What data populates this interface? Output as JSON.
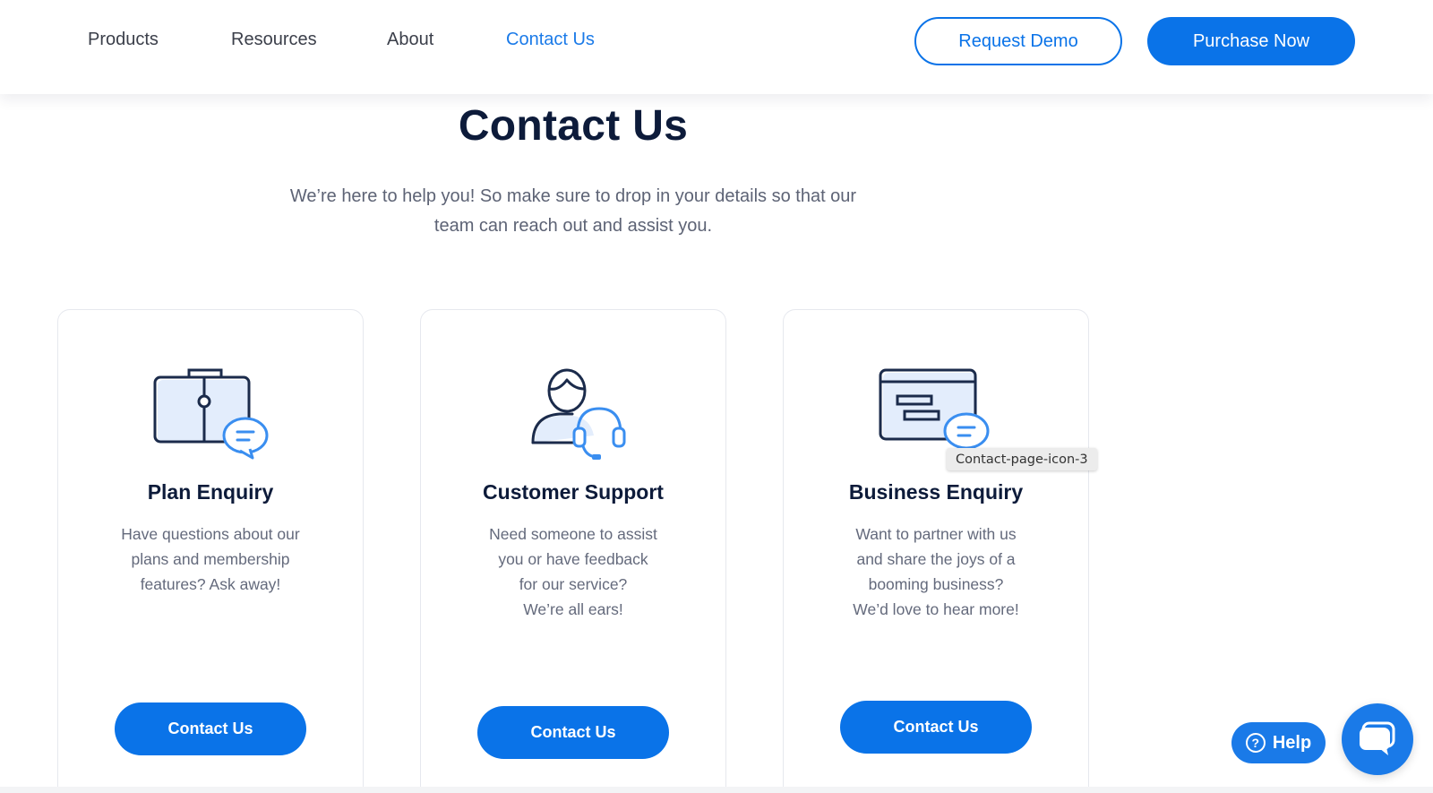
{
  "nav": {
    "items": [
      {
        "label": "Products"
      },
      {
        "label": "Resources"
      },
      {
        "label": "About"
      },
      {
        "label": "Contact Us"
      }
    ],
    "request_demo": "Request Demo",
    "purchase_now": "Purchase Now"
  },
  "hero": {
    "title": "Contact Us",
    "subtitle": "We’re here to help you! So make sure to drop in your details so that our team can reach out and assist you."
  },
  "cards": [
    {
      "title": "Plan Enquiry",
      "desc": [
        "Have questions about our",
        "plans and membership",
        "features? Ask away!"
      ],
      "button": "Contact Us",
      "icon": "briefcase-chat-icon"
    },
    {
      "title": "Customer Support",
      "desc": [
        "Need someone to assist",
        "you or have feedback",
        "for our service?",
        "We’re all ears!"
      ],
      "button": "Contact Us",
      "icon": "support-agent-headset-icon"
    },
    {
      "title": "Business Enquiry",
      "desc": [
        "Want to partner with us",
        "and share the joys of a",
        "booming business?",
        "We’d love to hear more!"
      ],
      "button": "Contact Us",
      "icon": "browser-chat-icon"
    }
  ],
  "tooltip": "Contact-page-icon-3",
  "help": {
    "label": "Help",
    "icon": "question-circle-icon"
  },
  "chat": {
    "icon": "chat-bubble-icon"
  },
  "colors": {
    "accent": "#0a73e8",
    "heading": "#0d1b3a",
    "body_text": "#646a7c",
    "nav_active": "#1a7ae8"
  }
}
